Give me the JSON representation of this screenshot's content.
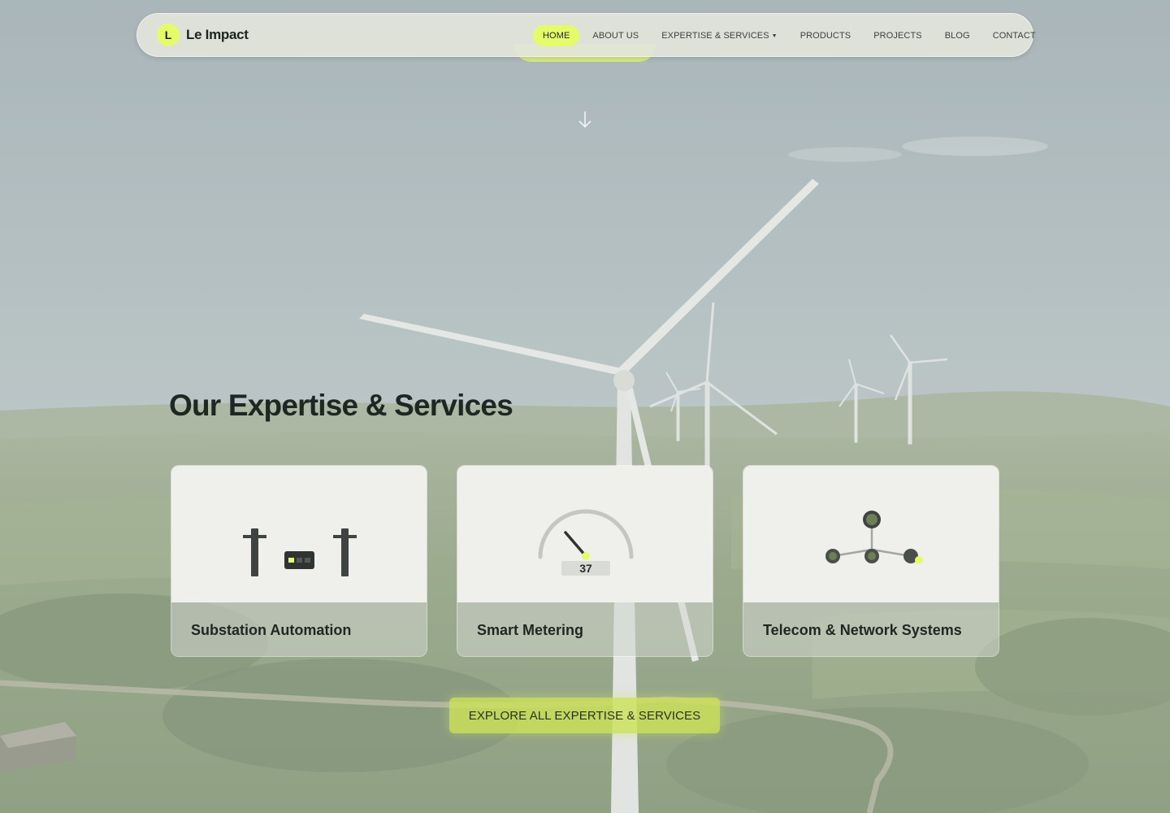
{
  "brand": {
    "logo_letter": "L",
    "name": "Le Impact"
  },
  "nav": {
    "items": [
      {
        "label": "HOME",
        "active": true
      },
      {
        "label": "ABOUT US"
      },
      {
        "label": "EXPERTISE & SERVICES",
        "has_dropdown": true,
        "caret": "▼"
      },
      {
        "label": "PRODUCTS"
      },
      {
        "label": "PROJECTS"
      },
      {
        "label": "BLOG"
      },
      {
        "label": "CONTACT"
      }
    ]
  },
  "section": {
    "title": "Our Expertise & Services",
    "cards": [
      {
        "title": "Substation Automation",
        "icon": "substation-icon"
      },
      {
        "title": "Smart Metering",
        "icon": "gauge-icon",
        "gauge_value": "37"
      },
      {
        "title": "Telecom & Network Systems",
        "icon": "network-nodes-icon"
      }
    ],
    "cta_label": "EXPLORE ALL EXPERTISE & SERVICES"
  },
  "colors": {
    "accent": "#e6fb6a",
    "card_bg": "#eff0ec",
    "text_dark": "#1f2723",
    "icon_dark": "#3f4341"
  }
}
